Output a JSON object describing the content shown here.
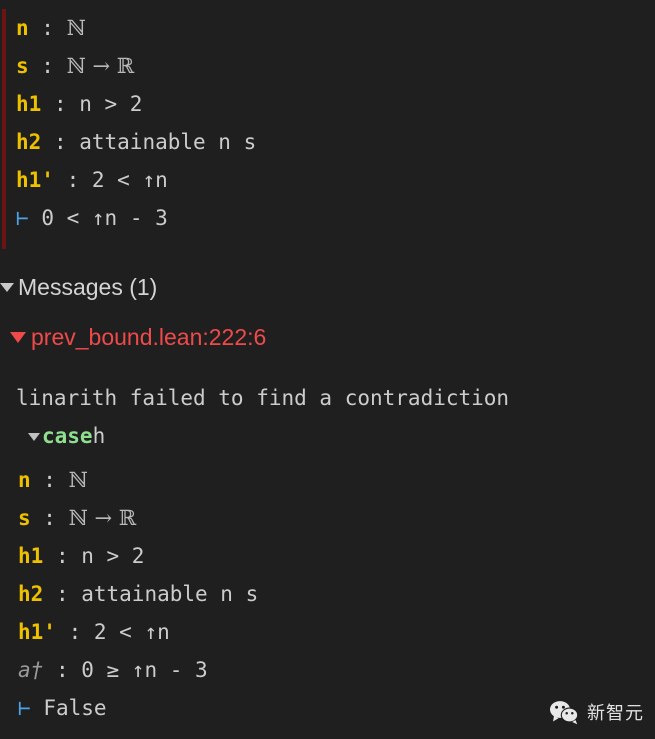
{
  "colors": {
    "background": "#1f1f1f",
    "text": "#cccccc",
    "hypothesis_name": "#eec100",
    "turnstile": "#4da3e8",
    "error_red": "#ef4a4a",
    "accent_bar": "#6b1414",
    "keyword_green": "#8fdf8f",
    "anonymous_name": "#9a9a9a"
  },
  "goal_block": {
    "name": "main-goal",
    "lines": [
      {
        "name": "n",
        "anonymous": false,
        "sep": " : ",
        "body": "ℕ"
      },
      {
        "name": "s",
        "anonymous": false,
        "sep": " : ",
        "body": "ℕ → ℝ"
      },
      {
        "name": "h1",
        "anonymous": false,
        "sep": " : ",
        "body": "n > 2"
      },
      {
        "name": "h2",
        "anonymous": false,
        "sep": " : ",
        "body": "attainable n s"
      },
      {
        "name": "h1'",
        "anonymous": false,
        "sep": " : ",
        "body": "2 < ↑n"
      }
    ],
    "goal": {
      "turnstile": "⊢",
      "body": "0 < ↑n - 3"
    }
  },
  "messages": {
    "header_label": "Messages (1)",
    "header_expanded": true,
    "error": {
      "file_location": "prev_bound.lean:222:6",
      "expanded": true,
      "summary": "linarith failed to find a contradiction",
      "case": {
        "keyword": "case",
        "label": "h",
        "expanded": true
      },
      "context": {
        "lines": [
          {
            "name": "n",
            "anonymous": false,
            "sep": " : ",
            "body": "ℕ"
          },
          {
            "name": "s",
            "anonymous": false,
            "sep": " : ",
            "body": "ℕ → ℝ"
          },
          {
            "name": "h1",
            "anonymous": false,
            "sep": " : ",
            "body": "n > 2"
          },
          {
            "name": "h2",
            "anonymous": false,
            "sep": " : ",
            "body": "attainable n s"
          },
          {
            "name": "h1'",
            "anonymous": false,
            "sep": " : ",
            "body": "2 < ↑n"
          },
          {
            "name": "a†",
            "anonymous": true,
            "sep": " : ",
            "body": "0 ≥ ↑n - 3"
          }
        ],
        "goal": {
          "turnstile": "⊢",
          "body": "False"
        }
      }
    }
  },
  "watermark": {
    "icon": "wechat-icon",
    "label": "新智元"
  }
}
